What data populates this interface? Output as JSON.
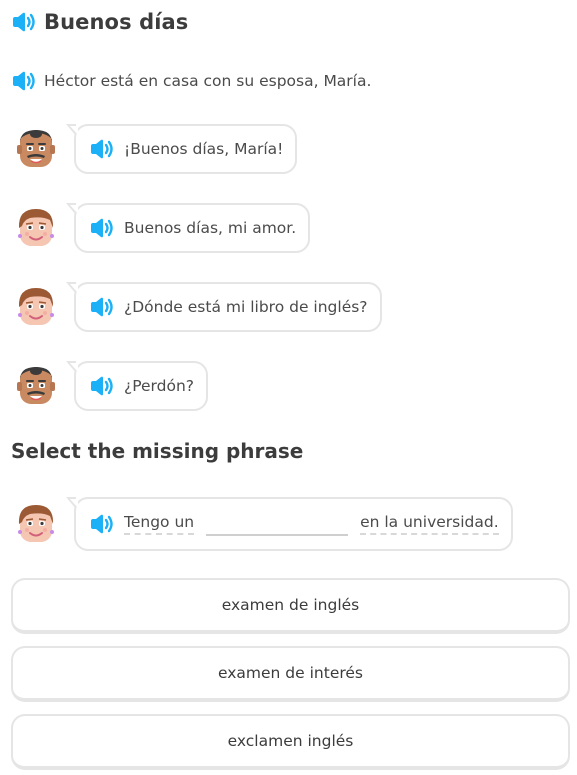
{
  "header": {
    "title": "Buenos días"
  },
  "intro": {
    "text": "Héctor está en casa con su esposa, María."
  },
  "dialogue": [
    {
      "speaker": "Héctor",
      "text": "¡Buenos días, María!"
    },
    {
      "speaker": "María",
      "text": "Buenos días, mi amor."
    },
    {
      "speaker": "María",
      "text": "¿Dónde está mi libro de inglés?"
    },
    {
      "speaker": "Héctor",
      "text": "¿Perdón?"
    }
  ],
  "question": {
    "prompt": "Select the missing phrase",
    "before": "Tengo un",
    "after": "en la universidad."
  },
  "options": [
    {
      "label": "examen de inglés"
    },
    {
      "label": "examen de interés"
    },
    {
      "label": "exclamen inglés"
    }
  ],
  "colors": {
    "accent": "#1cb0f6",
    "border": "#e5e5e5",
    "text": "#4b4b4b"
  },
  "icons": [
    "speaker-icon",
    "hector-avatar",
    "maria-avatar"
  ]
}
